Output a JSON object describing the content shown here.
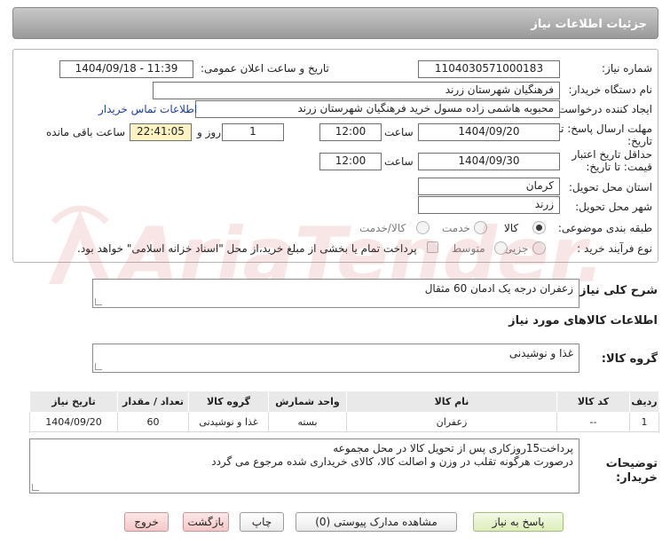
{
  "header": {
    "title": "جزئیات اطلاعات نیاز"
  },
  "form": {
    "need_number": {
      "label": "شماره نیاز:",
      "value": "1104030571000183"
    },
    "announce_datetime": {
      "label": "تاریخ و ساعت اعلان عمومی:",
      "value": "1404/09/18 - 11:39"
    },
    "buyer_org": {
      "label": "نام دستگاه خریدار:",
      "value": "فرهنگیان شهرستان زرند"
    },
    "requester": {
      "label": "ایجاد کننده درخواست:",
      "value": "محبوبه هاشمی زاده مسول خرید فرهنگیان شهرستان زرند",
      "contact_link": "اطلاعات تماس خریدار"
    },
    "deadline": {
      "label_line1": "مهلت ارسال پاسخ: تا",
      "label_line2": "تاریخ:",
      "date": "1404/09/20",
      "time_label": "ساعت",
      "time": "12:00",
      "days": "1",
      "days_label": "روز و",
      "remaining": "22:41:05",
      "remaining_label": "ساعت باقی مانده"
    },
    "price_validity": {
      "label_line1": "حداقل تاریخ اعتبار",
      "label_line2": "قیمت: تا تاریخ:",
      "date": "1404/09/30",
      "time_label": "ساعت",
      "time": "12:00"
    },
    "province": {
      "label": "استان محل تحویل:",
      "value": "کرمان"
    },
    "city": {
      "label": "شهر محل تحویل:",
      "value": "زرند"
    },
    "category": {
      "label": "طبقه بندی موضوعی:",
      "options": [
        "کالا",
        "خدمت",
        "کالا/خدمت"
      ],
      "selected": "کالا"
    },
    "process": {
      "label": "نوع فرآیند خرید :",
      "options": [
        "جزیی",
        "متوسط"
      ],
      "note": "پرداخت تمام یا بخشی از مبلغ خرید،از محل \"اسناد خزانه اسلامی\" خواهد بود."
    }
  },
  "description": {
    "label": "شرح کلی نیاز:",
    "value": "زعفران درجه یک ادمان 60 مثقال"
  },
  "goods_info": {
    "title": "اطلاعات کالاهای مورد نیاز",
    "group_label": "گروه کالا:",
    "group_value": "غذا و نوشیدنی"
  },
  "table": {
    "headers": [
      "ردیف",
      "کد کالا",
      "نام کالا",
      "واحد شمارش",
      "گروه کالا",
      "تعداد / مقدار",
      "تاریخ نیاز"
    ],
    "rows": [
      [
        "1",
        "--",
        "زعفران",
        "بسته",
        "غذا و نوشیدنی",
        "60",
        "1404/09/20"
      ]
    ]
  },
  "buyer_notes": {
    "label_line1": "توضیحات",
    "label_line2": "خریدار:",
    "line1": "پرداخت15روزکاری پس از تحویل کالا در محل مجموعه",
    "line2": "درصورت هرگونه تقلب در وزن و اصالت کالا، کالای خریداری شده مرجوع می گردد"
  },
  "buttons": {
    "reply": "پاسخ به نیاز",
    "attachments": "مشاهده مدارک پیوستی (0)",
    "print": "چاپ",
    "back": "بازگشت",
    "exit": "خروج"
  },
  "watermark": {
    "text": "AriaTender.neT"
  },
  "colors": {
    "header_bg": "#a9a9a9",
    "link": "#1b3ea8",
    "remaining_bg": "#fdf2c2",
    "reply_button": "#dcedb8",
    "exit_button": "#f4c7c7",
    "watermark": "#d0494a"
  }
}
